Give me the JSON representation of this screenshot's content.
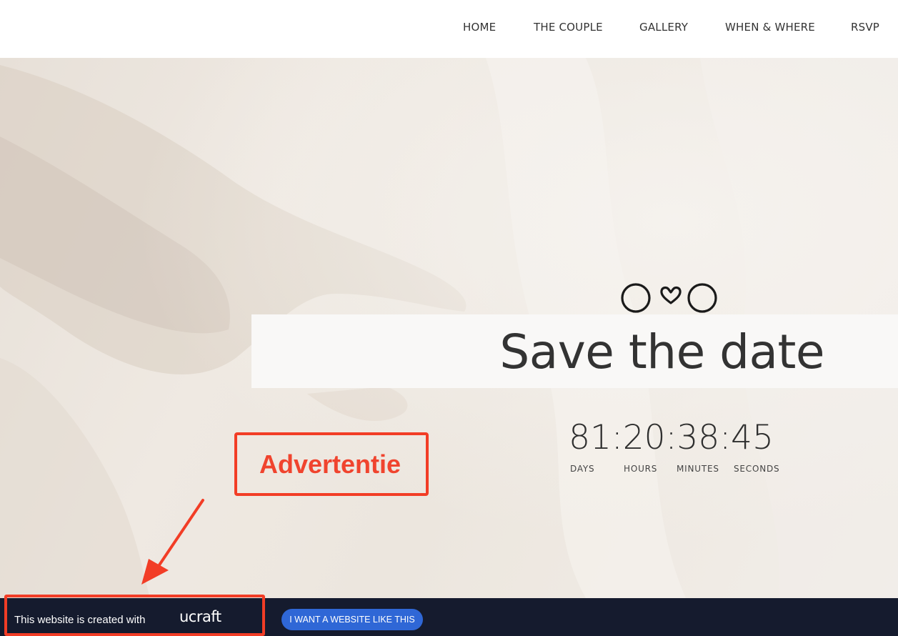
{
  "nav": {
    "items": [
      {
        "label": "HOME"
      },
      {
        "label": "THE COUPLE"
      },
      {
        "label": "GALLERY"
      },
      {
        "label": "WHEN & WHERE"
      },
      {
        "label": "RSVP"
      }
    ]
  },
  "hero": {
    "icon": "couple-heart-icon",
    "title": "Save the date",
    "countdown": {
      "display": "81:20:38:45",
      "labels": [
        "DAYS",
        "HOURS",
        "MINUTES",
        "SECONDS"
      ]
    }
  },
  "annotation": {
    "label": "Advertentie",
    "color": "#f23d26"
  },
  "footer": {
    "text": "This website is created with",
    "brand": "ucraft",
    "cta_label": "I WANT A WEBSITE LIKE THIS",
    "background": "#151b2e",
    "cta_color": "#2f67d6"
  }
}
